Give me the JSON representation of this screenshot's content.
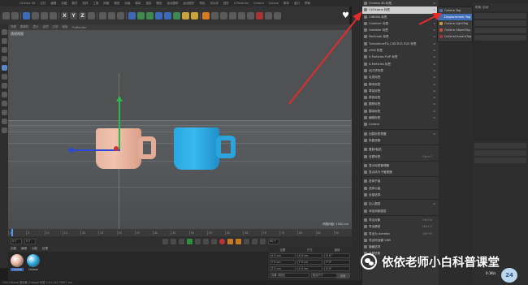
{
  "menubar": {
    "items": [
      "Cinema 4D",
      "文件",
      "编辑",
      "创建",
      "模式",
      "选择",
      "工具",
      "网格",
      "捕捉",
      "动画",
      "模拟",
      "渲染",
      "雕刻",
      "运动跟踪",
      "运动图形",
      "角色",
      "流水线",
      "插件",
      "X-Particles",
      "Corona",
      "Octane",
      "脚本",
      "窗口",
      "帮助"
    ]
  },
  "viewport": {
    "label": "透视视图",
    "tabs": [
      "查看",
      "摄像机",
      "显示",
      "选项",
      "过滤",
      "面板",
      "ProRender"
    ],
    "status": "网格间距: 1000 cm",
    "colors": {
      "mug_left": "#e8b39c",
      "mug_right": "#2aa8e0"
    }
  },
  "menu1": {
    "items": [
      {
        "label": "Cinema 4D 标签",
        "arrow": "▸"
      },
      {
        "label": "C4Octane 标签",
        "arrow": "▸",
        "highlight": true
      },
      {
        "label": "CINEMA 标签",
        "arrow": "▸"
      },
      {
        "label": "Coloriser 标签",
        "arrow": "▸"
      },
      {
        "label": "Greebler 标签",
        "arrow": "▸"
      },
      {
        "label": "MoGraph 标签",
        "arrow": "▸"
      },
      {
        "label": "TurbulenceFD_C4D R21 R20 标签",
        "arrow": "▸"
      },
      {
        "label": "UVW 标签",
        "arrow": "▸"
      },
      {
        "label": "X-Particles FLIP 标签",
        "arrow": "▸"
      },
      {
        "label": "X-Particles 标签",
        "arrow": "▸"
      },
      {
        "label": "动力学标签",
        "arrow": "▸"
      },
      {
        "label": "毛发标签",
        "arrow": "▸"
      },
      {
        "label": "脚本标签",
        "arrow": "▸"
      },
      {
        "label": "草绘标签",
        "arrow": "▸"
      },
      {
        "label": "角色标签",
        "arrow": "▸"
      },
      {
        "label": "跟踪标签",
        "arrow": "▸"
      },
      {
        "label": "模拟标签",
        "arrow": "▸"
      },
      {
        "label": "编程标签",
        "arrow": "▸"
      },
      {
        "label": "Corona",
        "arrow": ""
      },
      {
        "label": "",
        "divider": true
      },
      {
        "label": "加载标签预置",
        "arrow": "▸"
      },
      {
        "label": "恢复选集",
        "arrow": ""
      },
      {
        "label": "",
        "divider": true
      },
      {
        "label": "复制/粘贴",
        "arrow": ""
      },
      {
        "label": "还原标签",
        "arrow": "",
        "shortcut": "Ctrl+C"
      },
      {
        "label": "",
        "divider": true
      },
      {
        "label": "显示标签管理器",
        "arrow": ""
      },
      {
        "label": "显示执行子管理器",
        "arrow": ""
      },
      {
        "label": "",
        "divider": true
      },
      {
        "label": "选择子级",
        "arrow": ""
      },
      {
        "label": "选择父级",
        "arrow": ""
      },
      {
        "label": "全部选择",
        "arrow": ""
      },
      {
        "label": "",
        "divider": true
      },
      {
        "label": "加入图层",
        "arrow": "▸"
      },
      {
        "label": "添加到新图层",
        "arrow": ""
      },
      {
        "label": "",
        "divider": true
      },
      {
        "label": "导出对象",
        "arrow": "",
        "shortcut": "Ctrl+A"
      },
      {
        "label": "导出模型",
        "arrow": "",
        "shortcut": "Ctrl+G"
      },
      {
        "label": "导出为 Alembic",
        "arrow": "",
        "shortcut": "Ctrl+E"
      },
      {
        "label": "导出时创建 VDB",
        "arrow": ""
      },
      {
        "label": "隐藏选项",
        "arrow": ""
      },
      {
        "label": "还原选集",
        "arrow": ""
      }
    ]
  },
  "menu2": {
    "items": [
      {
        "label": "Octane Tag",
        "color": "#4a6ea8"
      },
      {
        "label": "Displacement Tag",
        "color": "#4a6ea8",
        "highlight": true
      },
      {
        "label": "Octane LightTag",
        "color": "#c99a3b"
      },
      {
        "label": "Octane ObjectTag",
        "color": "#c94f3b"
      },
      {
        "label": "OctaneCameraTag",
        "color": "#a33"
      }
    ]
  },
  "right_panel": {
    "header": "布局: 启动"
  },
  "timeline": {
    "ticks": [
      "0",
      "5",
      "10",
      "15",
      "20",
      "25",
      "30",
      "35",
      "40",
      "45",
      "50",
      "55",
      "60",
      "65",
      "70",
      "75",
      "80",
      "85",
      "90"
    ],
    "frame_field": "0 F",
    "start_field": "0 F",
    "end_field": "90 F"
  },
  "materials": {
    "tabs": [
      "创建",
      "编辑",
      "功能",
      "纹理"
    ],
    "items": [
      {
        "name": "Octane",
        "color": "#e8b39c"
      },
      {
        "name": "Octane",
        "color": "#2aa8e0"
      }
    ]
  },
  "coords": {
    "headers": [
      "位置",
      "尺寸",
      "旋转"
    ],
    "rows": [
      [
        "X 0 cm",
        "X 0 cm",
        "H 0°"
      ],
      [
        "Y 0 cm",
        "Y 0 cm",
        "P 0°"
      ],
      [
        "Z 0 cm",
        "Z 0 cm",
        "B 0°"
      ]
    ],
    "mode": "对象 (相对)",
    "size_mode": "绝对尺寸",
    "apply": "应用"
  },
  "statusbar": {
    "text": "C4D Octane 渲染器 [Octane 标签 2.0.1 [X] 71007 ms"
  },
  "watermark": {
    "text": "依依老师小白科普课堂"
  },
  "overlay": {
    "fps": "0.1K/s",
    "badge": "24"
  }
}
